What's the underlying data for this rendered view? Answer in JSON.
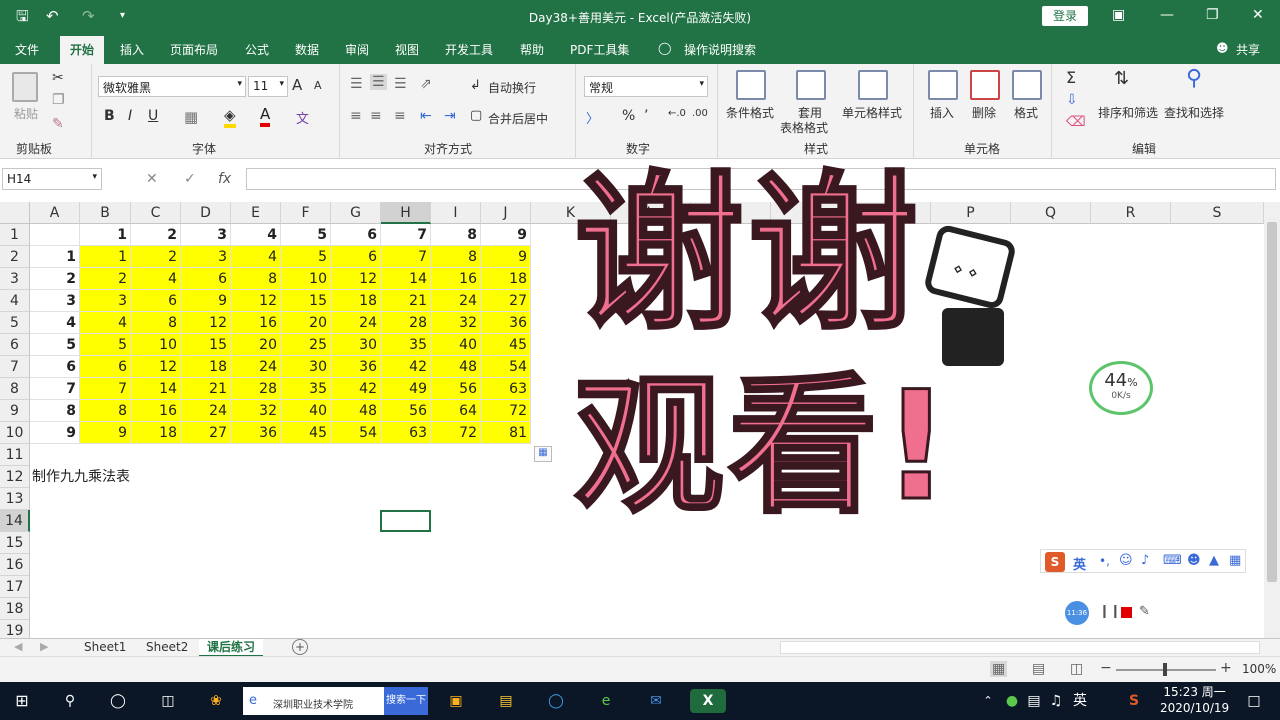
{
  "window": {
    "title": "Day38+善用美元 - Excel(产品激活失败)",
    "login_label": "登录",
    "quick_access": [
      "save-icon",
      "undo-icon",
      "redo-icon",
      "customize-icon"
    ]
  },
  "menu": {
    "tabs": [
      "文件",
      "开始",
      "插入",
      "页面布局",
      "公式",
      "数据",
      "审阅",
      "视图",
      "开发工具",
      "帮助",
      "PDF工具集"
    ],
    "active_tab": "开始",
    "tellme": "操作说明搜索",
    "share": "共享"
  },
  "ribbon": {
    "clipboard": {
      "label": "剪贴板",
      "paste": "粘贴"
    },
    "font": {
      "label": "字体",
      "family": "微软雅黑",
      "size": "11",
      "bold": "B",
      "italic": "I",
      "underline": "U",
      "grow": "A",
      "shrink": "A",
      "wen": "文"
    },
    "align": {
      "label": "对齐方式",
      "wrap": "自动换行",
      "merge": "合并后居中"
    },
    "number": {
      "label": "数字",
      "format": "常规",
      "pct": "%"
    },
    "styles": {
      "label": "样式",
      "cond": "条件格式",
      "table_line1": "套用",
      "table_line2": "表格格式",
      "cell": "单元格样式"
    },
    "cells": {
      "label": "单元格",
      "insert": "插入",
      "delete": "删除",
      "format": "格式"
    },
    "edit": {
      "label": "编辑",
      "sort": "排序和筛选",
      "find": "查找和选择"
    }
  },
  "formula_bar": {
    "name_box": "H14",
    "fx": "fx"
  },
  "grid": {
    "columns": [
      "A",
      "B",
      "C",
      "D",
      "E",
      "F",
      "G",
      "H",
      "I",
      "J",
      "K",
      "L",
      "M",
      "N",
      "O",
      "P",
      "Q",
      "R",
      "S"
    ],
    "rows": [
      "1",
      "2",
      "3",
      "4",
      "5",
      "6",
      "7",
      "8",
      "9",
      "10",
      "11",
      "12",
      "13",
      "14",
      "15",
      "16",
      "17",
      "18",
      "19"
    ],
    "header_row": [
      "1",
      "2",
      "3",
      "4",
      "5",
      "6",
      "7",
      "8",
      "9"
    ],
    "row_labels": [
      "1",
      "2",
      "3",
      "4",
      "5",
      "6",
      "7",
      "8",
      "9"
    ],
    "table": [
      [
        "1",
        "2",
        "3",
        "4",
        "5",
        "6",
        "7",
        "8",
        "9"
      ],
      [
        "2",
        "4",
        "6",
        "8",
        "10",
        "12",
        "14",
        "16",
        "18"
      ],
      [
        "3",
        "6",
        "9",
        "12",
        "15",
        "18",
        "21",
        "24",
        "27"
      ],
      [
        "4",
        "8",
        "12",
        "16",
        "20",
        "24",
        "28",
        "32",
        "36"
      ],
      [
        "5",
        "10",
        "15",
        "20",
        "25",
        "30",
        "35",
        "40",
        "45"
      ],
      [
        "6",
        "12",
        "18",
        "24",
        "30",
        "36",
        "42",
        "48",
        "54"
      ],
      [
        "7",
        "14",
        "21",
        "28",
        "35",
        "42",
        "49",
        "56",
        "63"
      ],
      [
        "8",
        "16",
        "24",
        "32",
        "40",
        "48",
        "56",
        "64",
        "72"
      ],
      [
        "9",
        "18",
        "27",
        "36",
        "45",
        "54",
        "63",
        "72",
        "81"
      ]
    ],
    "note": "制作九九乘法表"
  },
  "overlay": {
    "line1": "谢谢",
    "line2": "观看!",
    "speed_pct": "44",
    "pct_sign": "%",
    "speed_rate": "0K/s",
    "ime_label": "英",
    "rec_time": "11:36"
  },
  "sheets": {
    "tabs": [
      "Sheet1",
      "Sheet2",
      "课后练习"
    ],
    "active": "课后练习"
  },
  "status": {
    "zoom": "100%"
  },
  "taskbar": {
    "search_text": "深圳职业技术学院",
    "search_button": "搜索一下",
    "ime": "英",
    "time": "15:23 周一",
    "date": "2020/10/19"
  }
}
